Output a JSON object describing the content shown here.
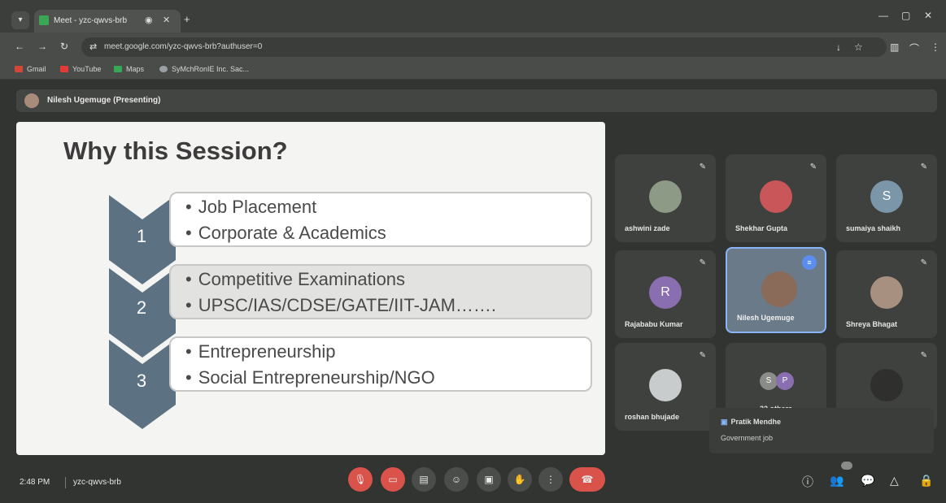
{
  "browser": {
    "tab_title": "Meet - yzc-qwvs-brb",
    "url": "meet.google.com/yzc-qwvs-brb?authuser=0",
    "bookmarks": [
      "Gmail",
      "YouTube",
      "Maps",
      "SyMchRonIE Inc. Sac..."
    ]
  },
  "meet": {
    "presenter": "Nilesh Ugemuge (Presenting)",
    "time": "2:48 PM",
    "meeting_code": "yzc-qwvs-brb"
  },
  "slide": {
    "title": "Why this Session?",
    "items": [
      {
        "number": "1",
        "lines": [
          "Job Placement",
          "Corporate & Academics"
        ]
      },
      {
        "number": "2",
        "lines": [
          "Competitive Examinations",
          "UPSC/IAS/CDSE/GATE/IIT-JAM……."
        ]
      },
      {
        "number": "3",
        "lines": [
          "Entrepreneurship",
          "Social Entrepreneurship/NGO"
        ]
      }
    ]
  },
  "participants": [
    {
      "name": "ashwini zade"
    },
    {
      "name": "Shekhar Gupta"
    },
    {
      "name": "sumaiya shaikh",
      "initial": "S"
    },
    {
      "name": "Rajababu Kumar",
      "initial": "R"
    },
    {
      "name": "Nilesh Ugemuge"
    },
    {
      "name": "Shreya Bhagat"
    },
    {
      "name": "roshan bhujade"
    },
    {
      "name": "32 others",
      "initials": [
        "S",
        "P"
      ]
    },
    {
      "name": ""
    }
  ],
  "tooltip": {
    "name": "Pratik Mendhe",
    "message": "Government job"
  },
  "colors": {
    "chevron": "#5c7282",
    "end_call": "#d9534a"
  }
}
